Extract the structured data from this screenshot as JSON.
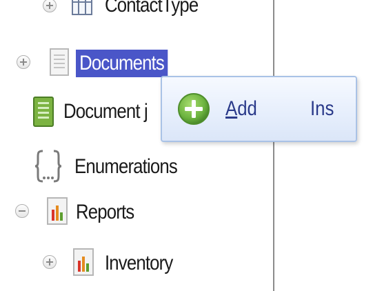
{
  "tree": {
    "items": [
      {
        "label": "ContactType",
        "icon": "table-icon",
        "expander": "plus"
      },
      {
        "label": "Documents",
        "icon": "documents-icon",
        "expander": "plus",
        "selected": true
      },
      {
        "label": "DocumentJournals",
        "visible_label": "Document j",
        "icon": "journal-icon"
      },
      {
        "label": "Enumerations",
        "icon": "enumerations-icon"
      },
      {
        "label": "Reports",
        "icon": "report-icon",
        "expander": "minus"
      },
      {
        "label": "Inventory",
        "icon": "report-icon",
        "expander": "plus"
      }
    ]
  },
  "context_menu": {
    "items": [
      {
        "label_accel": "A",
        "label_rest": "dd",
        "shortcut": "Ins",
        "icon": "add-icon"
      }
    ]
  },
  "colors": {
    "selection": "#4a56c8",
    "menu_text": "#2a3a8a",
    "menu_border": "#a9c2e6",
    "add_green": "#6cb33f"
  }
}
